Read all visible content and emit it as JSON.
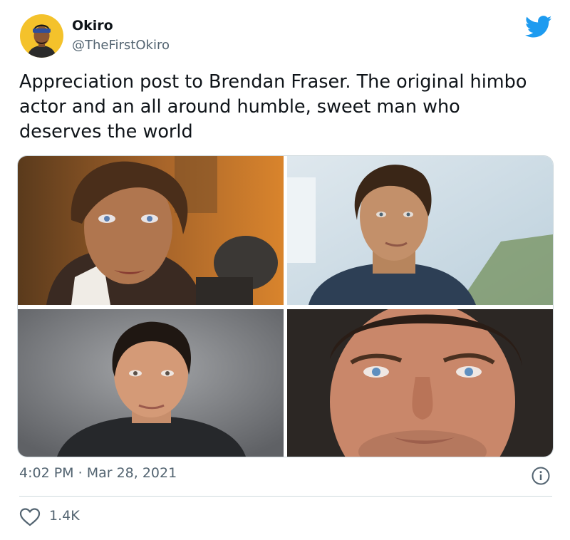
{
  "tweet": {
    "author_name": "Okiro",
    "author_handle": "@TheFirstOkiro",
    "text": "Appreciation post to Brendan Fraser. The original himbo actor and an all around humble, sweet man who deserves the world",
    "time": "4:02 PM",
    "separator": "·",
    "date": "Mar 28, 2021",
    "likes": "1.4K"
  },
  "icons": {
    "logo": "twitter-bird-icon",
    "info": "info-icon",
    "like": "heart-icon"
  },
  "colors": {
    "twitter_blue": "#1d9bf0",
    "text": "#0f1419",
    "secondary": "#536471",
    "border": "#cfd9de"
  },
  "photos": [
    "photo-young-actor-with-revolver",
    "photo-young-actor-blue-jacket",
    "photo-actor-grey-background",
    "photo-actor-closeup"
  ]
}
